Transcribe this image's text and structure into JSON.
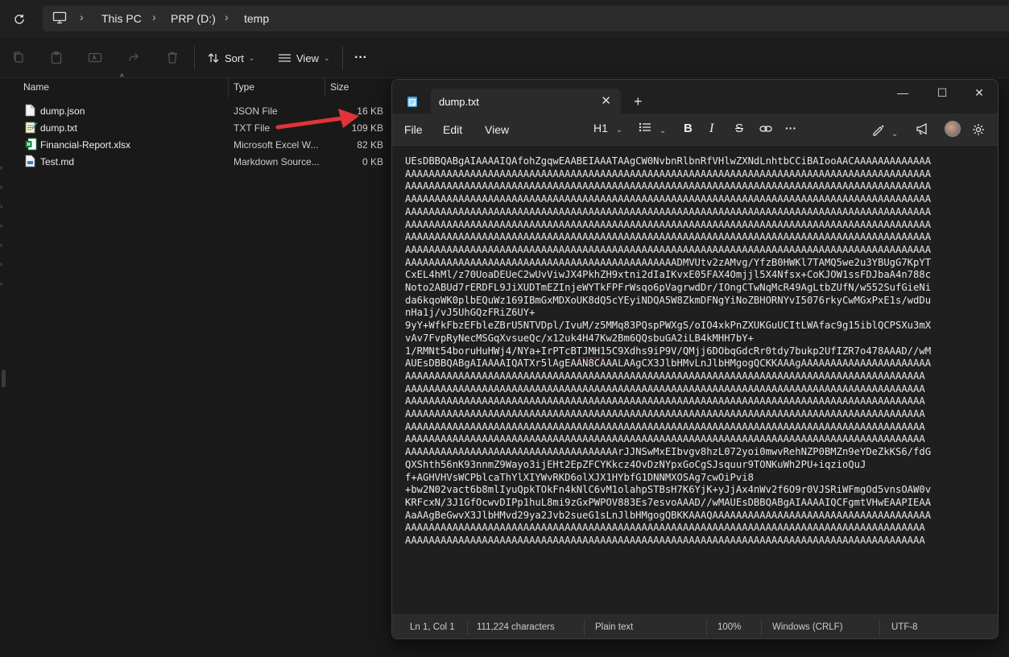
{
  "explorer": {
    "breadcrumb": [
      "This PC",
      "PRP (D:)",
      "temp"
    ],
    "toolbar": {
      "sort_label": "Sort",
      "view_label": "View",
      "more_label": "···"
    },
    "columns": {
      "name": "Name",
      "type": "Type",
      "size": "Size"
    },
    "files": [
      {
        "name": "dump.json",
        "type": "JSON File",
        "size": "16 KB",
        "icon": "json-file-icon"
      },
      {
        "name": "dump.txt",
        "type": "TXT File",
        "size": "109 KB",
        "icon": "txt-file-icon"
      },
      {
        "name": "Financial-Report.xlsx",
        "type": "Microsoft Excel W...",
        "size": "82 KB",
        "icon": "excel-file-icon"
      },
      {
        "name": "Test.md",
        "type": "Markdown Source...",
        "size": "0 KB",
        "icon": "md-file-icon"
      }
    ]
  },
  "notepad": {
    "tab_title": "dump.txt",
    "menu": [
      "File",
      "Edit",
      "View"
    ],
    "heading_label": "H1",
    "content": "UEsDBBQABgAIAAAAIQAfohZgqwEAABEIAAATAAgCW0NvbnRlbnRfVHlwZXNdLnhtbCCiBAIooAACAAAAAAAAAAAAA\nAAAAAAAAAAAAAAAAAAAAAAAAAAAAAAAAAAAAAAAAAAAAAAAAAAAAAAAAAAAAAAAAAAAAAAAAAAAAAAAAAAAAAAAAA\nAAAAAAAAAAAAAAAAAAAAAAAAAAAAAAAAAAAAAAAAAAAAAAAAAAAAAAAAAAAAAAAAAAAAAAAAAAAAAAAAAAAAAAAAA\nAAAAAAAAAAAAAAAAAAAAAAAAAAAAAAAAAAAAAAAAAAAAAAAAAAAAAAAAAAAAAAAAAAAAAAAAAAAAAAAAAAAAAAAAA\nAAAAAAAAAAAAAAAAAAAAAAAAAAAAAAAAAAAAAAAAAAAAAAAAAAAAAAAAAAAAAAAAAAAAAAAAAAAAAAAAAAAAAAAAA\nAAAAAAAAAAAAAAAAAAAAAAAAAAAAAAAAAAAAAAAAAAAAAAAAAAAAAAAAAAAAAAAAAAAAAAAAAAAAAAAAAAAAAAAAA\nAAAAAAAAAAAAAAAAAAAAAAAAAAAAAAAAAAAAAAAAAAAAAAAAAAAAAAAAAAAAAAAAAAAAAAAAAAAAAAAAAAAAAAAAA\nAAAAAAAAAAAAAAAAAAAAAAAAAAAAAAAAAAAAAAAAAAAAAAAAAAAAAAAAAAAAAAAAAAAAAAAAAAAAAAAAAAAAAAAAA\nAAAAAAAAAAAAAAAAAAAAAAAAAAAAAAAAAAAAAAAAAAAAAADMVUtv2zAMvg/YfzB0HWKl7TAMQ5we2u3YBUgG7KpYT\nCxEL4hMl/z70UoaDEUeC2wUvViwJX4PkhZH9xtni2dIaIKvxE05FAX4Omjjl5X4Nfsx+CoKJOW1ssFDJbaA4n788c\nNoto2ABUd7rERDFL9JiXUDTmEZInjeWYTkFPFrWsqo6pVagrwdDr/IOngCTwNqMcR49AgLtbZUfN/w552SufGieNi\nda6kqoWK0plbEQuWz169IBmGxMDXoUK8dQ5cYEyiNDQA5W8ZkmDFNgYiNoZBHORNYvI5076rkyCwMGxPxE1s/wdDu\nnHa1j/vJ5UhGQzFRiZ6UY+\n9yY+WfkFbzEFbleZBrU5NTVDpl/IvuM/z5MMq83PQspPWXgS/oIO4xkPnZXUKGuUCItLWAfac9g15iblQCPSXu3mX\nvAv7FvpRyNecMSGqXvsueQc/x12uk4H47Kw2Bm6QQsbuGA2iLB4kMHH7bY+\n1/RMNt54boruHuHWj4/NYa+IrPTcBTJMH15C9Xdhs9iP9V/QMjj6DObqGdcRr0tdy7bukp2UfIZR7o478AAAD//wM\nAUEsDBBQABgAIAAAAIQATXr5lAgEAAN8CAAALAAgCX3JlbHMvLnJlbHMgogQCKKAAAgAAAAAAAAAAAAAAAAAAAAAA\nAAAAAAAAAAAAAAAAAAAAAAAAAAAAAAAAAAAAAAAAAAAAAAAAAAAAAAAAAAAAAAAAAAAAAAAAAAAAAAAAAAAAAAAA\nAAAAAAAAAAAAAAAAAAAAAAAAAAAAAAAAAAAAAAAAAAAAAAAAAAAAAAAAAAAAAAAAAAAAAAAAAAAAAAAAAAAAAAAA\nAAAAAAAAAAAAAAAAAAAAAAAAAAAAAAAAAAAAAAAAAAAAAAAAAAAAAAAAAAAAAAAAAAAAAAAAAAAAAAAAAAAAAAAA\nAAAAAAAAAAAAAAAAAAAAAAAAAAAAAAAAAAAAAAAAAAAAAAAAAAAAAAAAAAAAAAAAAAAAAAAAAAAAAAAAAAAAAAAA\nAAAAAAAAAAAAAAAAAAAAAAAAAAAAAAAAAAAAAAAAAAAAAAAAAAAAAAAAAAAAAAAAAAAAAAAAAAAAAAAAAAAAAAAA\nAAAAAAAAAAAAAAAAAAAAAAAAAAAAAAAAAAAAAAAAAAAAAAAAAAAAAAAAAAAAAAAAAAAAAAAAAAAAAAAAAAAAAAAA\nAAAAAAAAAAAAAAAAAAAAAAAAAAAAAAAAAAAArJJNSwMxEIbvgv8hzL072yoi0mwvRehNZP0BMZn9eYDeZkKS6/fdG\nQXShth56nK93nnmZ9Wayo3ijEHt2EpZFCYKkcz4OvDzNYpxGoCgSJsquur9TONKuWh2PU+iqzioQuJ\nf+AGHVHVsWCPblcaThYlXIYWvRKD6olXJX1HYbfG1DNNMXOSAg7cwOiPvi8\n+bw2N02vact6b8mlIyuQpkTOkFn4kNlC6vM1olahpSTBsH7K6YjK+yJjAx4nWv2f6O9r0VJSRiWFmgOd5vnsOAW0v\nKRFcxN/3J1GfOcwvDIPp1huL8mi9zGxPWPOV883Es7esvoAAAD//wMAUEsDBBQABgAIAAAAIQCFgmtVHwEAAPIEAA\nAaAAgBeGwvX3JlbHMvd29ya2Jvb2sueG1sLnJlbHMgogQBKKAAAQAAAAAAAAAAAAAAAAAAAAAAAAAAAAAAAAAAAAA\nAAAAAAAAAAAAAAAAAAAAAAAAAAAAAAAAAAAAAAAAAAAAAAAAAAAAAAAAAAAAAAAAAAAAAAAAAAAAAAAAAAAAAAAA\nAAAAAAAAAAAAAAAAAAAAAAAAAAAAAAAAAAAAAAAAAAAAAAAAAAAAAAAAAAAAAAAAAAAAAAAAAAAAAAAAAAAAAAAA",
    "status": {
      "position": "Ln 1, Col 1",
      "characters": "111,224 characters",
      "format": "Plain text",
      "zoom": "100%",
      "line_ending": "Windows (CRLF)",
      "encoding": "UTF-8"
    }
  },
  "colors": {
    "arrow": "#e0343a",
    "background": "#191919",
    "notepad_bg": "#1f1f1f"
  }
}
